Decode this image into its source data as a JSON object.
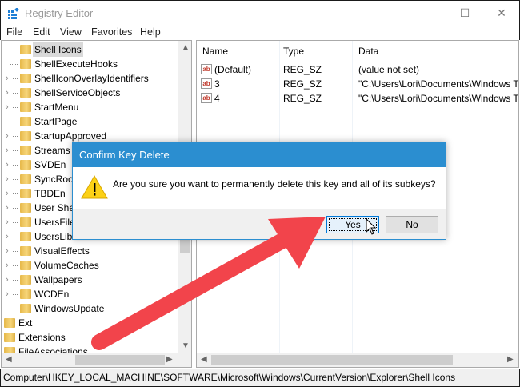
{
  "window": {
    "title": "Registry Editor",
    "minimize": "—",
    "maximize": "☐",
    "close": "✕"
  },
  "menu": [
    "File",
    "Edit",
    "View",
    "Favorites",
    "Help"
  ],
  "tree": [
    {
      "label": "Shell Icons",
      "selected": true,
      "expander": false,
      "level": 1
    },
    {
      "label": "ShellExecuteHooks",
      "expander": false,
      "level": 1
    },
    {
      "label": "ShellIconOverlayIdentifiers",
      "expander": true,
      "level": 1
    },
    {
      "label": "ShellServiceObjects",
      "expander": true,
      "level": 1
    },
    {
      "label": "StartMenu",
      "expander": true,
      "level": 1
    },
    {
      "label": "StartPage",
      "expander": false,
      "level": 1
    },
    {
      "label": "StartupApproved",
      "expander": true,
      "level": 1
    },
    {
      "label": "Streams",
      "expander": true,
      "level": 1
    },
    {
      "label": "SVDEn",
      "expander": true,
      "level": 1
    },
    {
      "label": "SyncRoot",
      "expander": true,
      "level": 1
    },
    {
      "label": "TBDEn",
      "expander": true,
      "level": 1
    },
    {
      "label": "User Shel",
      "expander": true,
      "level": 1
    },
    {
      "label": "UsersFile",
      "expander": true,
      "level": 1
    },
    {
      "label": "UsersLibr",
      "expander": true,
      "level": 1
    },
    {
      "label": "VisualEffects",
      "expander": true,
      "level": 1
    },
    {
      "label": "VolumeCaches",
      "expander": true,
      "level": 1
    },
    {
      "label": "Wallpapers",
      "expander": true,
      "level": 1
    },
    {
      "label": "WCDEn",
      "expander": true,
      "level": 1
    },
    {
      "label": "WindowsUpdate",
      "expander": false,
      "level": 1
    },
    {
      "label": "Ext",
      "expander": false,
      "level": 0
    },
    {
      "label": "Extensions",
      "expander": false,
      "level": 0
    },
    {
      "label": "FileAssociations",
      "expander": false,
      "level": 0
    }
  ],
  "list": {
    "columns": [
      "Name",
      "Type",
      "Data"
    ],
    "rows": [
      {
        "name": "(Default)",
        "type": "REG_SZ",
        "data": "(value not set)"
      },
      {
        "name": "3",
        "type": "REG_SZ",
        "data": "\"C:\\Users\\Lori\\Documents\\Windows T"
      },
      {
        "name": "4",
        "type": "REG_SZ",
        "data": "\"C:\\Users\\Lori\\Documents\\Windows T"
      }
    ]
  },
  "status": "Computer\\HKEY_LOCAL_MACHINE\\SOFTWARE\\Microsoft\\Windows\\CurrentVersion\\Explorer\\Shell Icons",
  "dialog": {
    "title": "Confirm Key Delete",
    "message": "Are you sure you want to permanently delete this key and all of its subkeys?",
    "yes": "Yes",
    "no": "No"
  },
  "colors": {
    "accent": "#2b8ed0",
    "annotation_arrow": "#f2444b"
  }
}
